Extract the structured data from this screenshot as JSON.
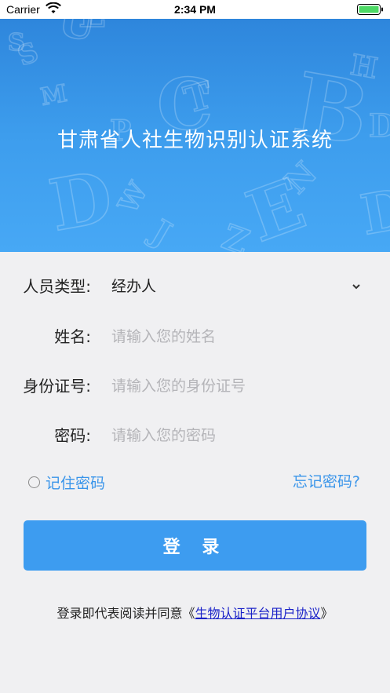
{
  "status_bar": {
    "carrier": "Carrier",
    "time": "2:34 PM",
    "wifi_icon": "wifi-icon",
    "battery_icon": "battery-icon"
  },
  "header": {
    "title": "甘肃省人社生物识别认证系统",
    "background_colors": [
      "#2e86dc",
      "#47a8f5"
    ],
    "decoration_letters": [
      "S",
      "U",
      "L",
      "C",
      "T",
      "B",
      "M",
      "D",
      "J",
      "W",
      "Z",
      "E",
      "N",
      "H",
      "D",
      "P",
      "S",
      "D"
    ]
  },
  "form": {
    "person_type": {
      "label": "人员类型:",
      "value": "经办人",
      "icon": "chevron-down-icon"
    },
    "name": {
      "label": "姓名:",
      "placeholder": "请输入您的姓名"
    },
    "id_number": {
      "label": "身份证号:",
      "placeholder": "请输入您的身份证号"
    },
    "password": {
      "label": "密码:",
      "placeholder": "请输入您的密码"
    }
  },
  "options": {
    "remember_password": "记住密码",
    "forgot_password": "忘记密码?"
  },
  "login_button": {
    "label": "登 录"
  },
  "agreement": {
    "prefix": "登录即代表阅读并同意《",
    "link": "生物认证平台用户协议",
    "suffix": "》"
  },
  "colors": {
    "accent": "#3d9cf0",
    "link": "#1a22c8",
    "background": "#f0f0f2"
  }
}
